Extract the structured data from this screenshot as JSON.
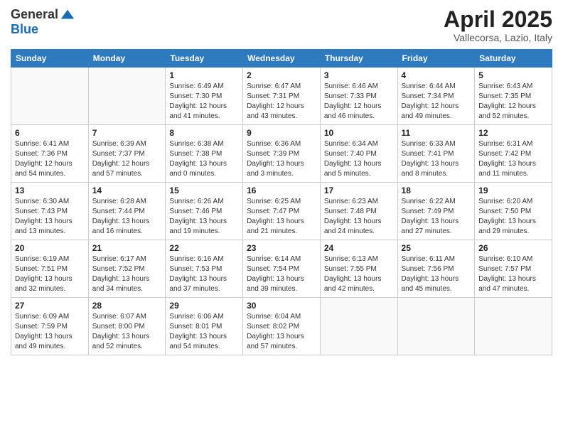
{
  "header": {
    "logo_general": "General",
    "logo_blue": "Blue",
    "month_title": "April 2025",
    "location": "Vallecorsa, Lazio, Italy"
  },
  "weekdays": [
    "Sunday",
    "Monday",
    "Tuesday",
    "Wednesday",
    "Thursday",
    "Friday",
    "Saturday"
  ],
  "weeks": [
    [
      {
        "day": "",
        "info": ""
      },
      {
        "day": "",
        "info": ""
      },
      {
        "day": "1",
        "info": "Sunrise: 6:49 AM\nSunset: 7:30 PM\nDaylight: 12 hours and 41 minutes."
      },
      {
        "day": "2",
        "info": "Sunrise: 6:47 AM\nSunset: 7:31 PM\nDaylight: 12 hours and 43 minutes."
      },
      {
        "day": "3",
        "info": "Sunrise: 6:46 AM\nSunset: 7:33 PM\nDaylight: 12 hours and 46 minutes."
      },
      {
        "day": "4",
        "info": "Sunrise: 6:44 AM\nSunset: 7:34 PM\nDaylight: 12 hours and 49 minutes."
      },
      {
        "day": "5",
        "info": "Sunrise: 6:43 AM\nSunset: 7:35 PM\nDaylight: 12 hours and 52 minutes."
      }
    ],
    [
      {
        "day": "6",
        "info": "Sunrise: 6:41 AM\nSunset: 7:36 PM\nDaylight: 12 hours and 54 minutes."
      },
      {
        "day": "7",
        "info": "Sunrise: 6:39 AM\nSunset: 7:37 PM\nDaylight: 12 hours and 57 minutes."
      },
      {
        "day": "8",
        "info": "Sunrise: 6:38 AM\nSunset: 7:38 PM\nDaylight: 13 hours and 0 minutes."
      },
      {
        "day": "9",
        "info": "Sunrise: 6:36 AM\nSunset: 7:39 PM\nDaylight: 13 hours and 3 minutes."
      },
      {
        "day": "10",
        "info": "Sunrise: 6:34 AM\nSunset: 7:40 PM\nDaylight: 13 hours and 5 minutes."
      },
      {
        "day": "11",
        "info": "Sunrise: 6:33 AM\nSunset: 7:41 PM\nDaylight: 13 hours and 8 minutes."
      },
      {
        "day": "12",
        "info": "Sunrise: 6:31 AM\nSunset: 7:42 PM\nDaylight: 13 hours and 11 minutes."
      }
    ],
    [
      {
        "day": "13",
        "info": "Sunrise: 6:30 AM\nSunset: 7:43 PM\nDaylight: 13 hours and 13 minutes."
      },
      {
        "day": "14",
        "info": "Sunrise: 6:28 AM\nSunset: 7:44 PM\nDaylight: 13 hours and 16 minutes."
      },
      {
        "day": "15",
        "info": "Sunrise: 6:26 AM\nSunset: 7:46 PM\nDaylight: 13 hours and 19 minutes."
      },
      {
        "day": "16",
        "info": "Sunrise: 6:25 AM\nSunset: 7:47 PM\nDaylight: 13 hours and 21 minutes."
      },
      {
        "day": "17",
        "info": "Sunrise: 6:23 AM\nSunset: 7:48 PM\nDaylight: 13 hours and 24 minutes."
      },
      {
        "day": "18",
        "info": "Sunrise: 6:22 AM\nSunset: 7:49 PM\nDaylight: 13 hours and 27 minutes."
      },
      {
        "day": "19",
        "info": "Sunrise: 6:20 AM\nSunset: 7:50 PM\nDaylight: 13 hours and 29 minutes."
      }
    ],
    [
      {
        "day": "20",
        "info": "Sunrise: 6:19 AM\nSunset: 7:51 PM\nDaylight: 13 hours and 32 minutes."
      },
      {
        "day": "21",
        "info": "Sunrise: 6:17 AM\nSunset: 7:52 PM\nDaylight: 13 hours and 34 minutes."
      },
      {
        "day": "22",
        "info": "Sunrise: 6:16 AM\nSunset: 7:53 PM\nDaylight: 13 hours and 37 minutes."
      },
      {
        "day": "23",
        "info": "Sunrise: 6:14 AM\nSunset: 7:54 PM\nDaylight: 13 hours and 39 minutes."
      },
      {
        "day": "24",
        "info": "Sunrise: 6:13 AM\nSunset: 7:55 PM\nDaylight: 13 hours and 42 minutes."
      },
      {
        "day": "25",
        "info": "Sunrise: 6:11 AM\nSunset: 7:56 PM\nDaylight: 13 hours and 45 minutes."
      },
      {
        "day": "26",
        "info": "Sunrise: 6:10 AM\nSunset: 7:57 PM\nDaylight: 13 hours and 47 minutes."
      }
    ],
    [
      {
        "day": "27",
        "info": "Sunrise: 6:09 AM\nSunset: 7:59 PM\nDaylight: 13 hours and 49 minutes."
      },
      {
        "day": "28",
        "info": "Sunrise: 6:07 AM\nSunset: 8:00 PM\nDaylight: 13 hours and 52 minutes."
      },
      {
        "day": "29",
        "info": "Sunrise: 6:06 AM\nSunset: 8:01 PM\nDaylight: 13 hours and 54 minutes."
      },
      {
        "day": "30",
        "info": "Sunrise: 6:04 AM\nSunset: 8:02 PM\nDaylight: 13 hours and 57 minutes."
      },
      {
        "day": "",
        "info": ""
      },
      {
        "day": "",
        "info": ""
      },
      {
        "day": "",
        "info": ""
      }
    ]
  ]
}
